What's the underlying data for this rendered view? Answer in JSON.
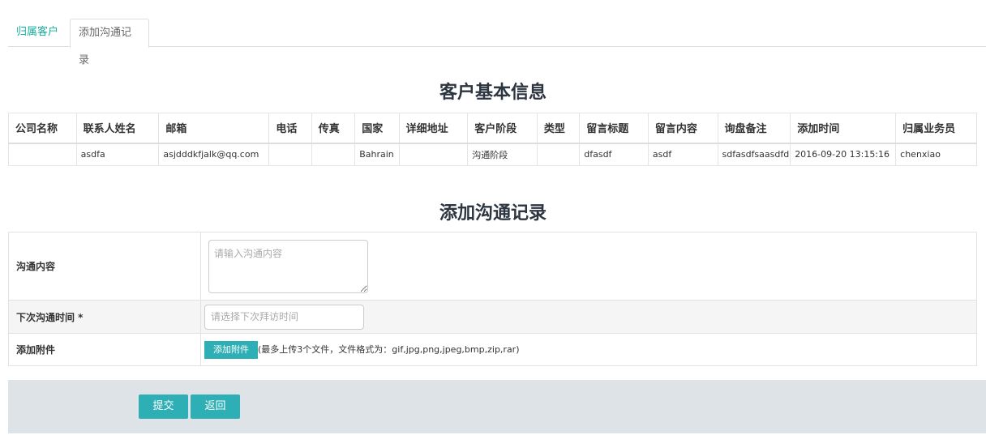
{
  "tabs": [
    {
      "label": "归属客户"
    },
    {
      "label": "添加沟通记录"
    }
  ],
  "info_section": {
    "title": "客户基本信息",
    "columns": [
      "公司名称",
      "联系人姓名",
      "邮箱",
      "电话",
      "传真",
      "国家",
      "详细地址",
      "客户阶段",
      "类型",
      "留言标题",
      "留言内容",
      "询盘备注",
      "添加时间",
      "归属业务员"
    ],
    "row": [
      "",
      "asdfa",
      "asjdddkfjalk@qq.com",
      "",
      "",
      "Bahrain",
      "",
      "沟通阶段",
      "",
      "dfasdf",
      "asdf",
      "sdfasdfsaasdfd",
      "2016-09-20 13:15:16",
      "chenxiao"
    ]
  },
  "form_section": {
    "title": "添加沟通记录",
    "content_label": "沟通内容",
    "content_placeholder": "请输入沟通内容",
    "next_time_label": "下次沟通时间 *",
    "next_time_placeholder": "请选择下次拜访时间",
    "attach_label": "添加附件",
    "attach_button": "添加附件",
    "attach_hint": "(最多上传3个文件，文件格式为：gif,jpg,png,jpeg,bmp,zip,rar)"
  },
  "actions": {
    "submit": "提交",
    "back": "返回"
  },
  "colors": {
    "accent": "#2eaeb5",
    "tab_active_text": "#1aae9f",
    "footer_bg": "#dde3e6"
  }
}
